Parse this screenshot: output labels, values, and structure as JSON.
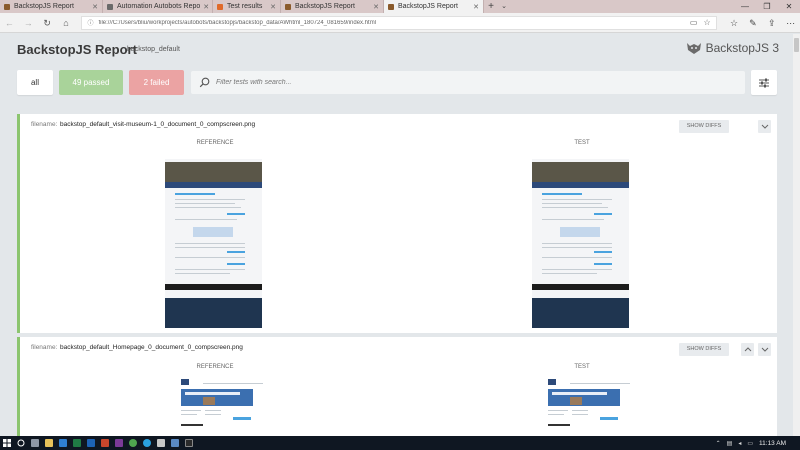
{
  "browser": {
    "tabs": [
      {
        "title": "BackstopJS Report",
        "active": false,
        "favicon_color": "#8a5a2b"
      },
      {
        "title": "Automation Autobots Repo",
        "active": false,
        "favicon_color": "#6a6a6a"
      },
      {
        "title": "Test results",
        "active": false,
        "favicon_color": "#e06a2a"
      },
      {
        "title": "BackstopJS Report",
        "active": false,
        "favicon_color": "#8a5a2b"
      },
      {
        "title": "BackstopJS Report",
        "active": true,
        "favicon_color": "#8a5a2b"
      }
    ],
    "url": "file:///C:/Users/bliu/workprojects/autobots/backstopjs/backstop_data/AWhtml_180724_081659/index.html"
  },
  "report": {
    "title": "BackstopJS Report",
    "subtitle": "backstop_default",
    "brand": "BackstopJS 3"
  },
  "filters": {
    "all_label": "all",
    "passed_label": "49 passed",
    "failed_label": "2 failed",
    "search_placeholder": "Filter tests with search..."
  },
  "tests": [
    {
      "filename_label": "filename:",
      "filename": "backstop_default_visit-museum-1_0_document_0_compscreen.png",
      "show_diffs_label": "SHOW DIFFS",
      "reference_label": "REFERENCE",
      "test_label": "TEST"
    },
    {
      "filename_label": "filename:",
      "filename": "backstop_default_Homepage_0_document_0_compscreen.png",
      "show_diffs_label": "SHOW DIFFS",
      "reference_label": "REFERENCE",
      "test_label": "TEST"
    }
  ],
  "taskbar": {
    "clock": "11:13 AM"
  },
  "colors": {
    "passed": "#a9d39a",
    "failed": "#eba3a3",
    "card_accent": "#8cc56f"
  }
}
